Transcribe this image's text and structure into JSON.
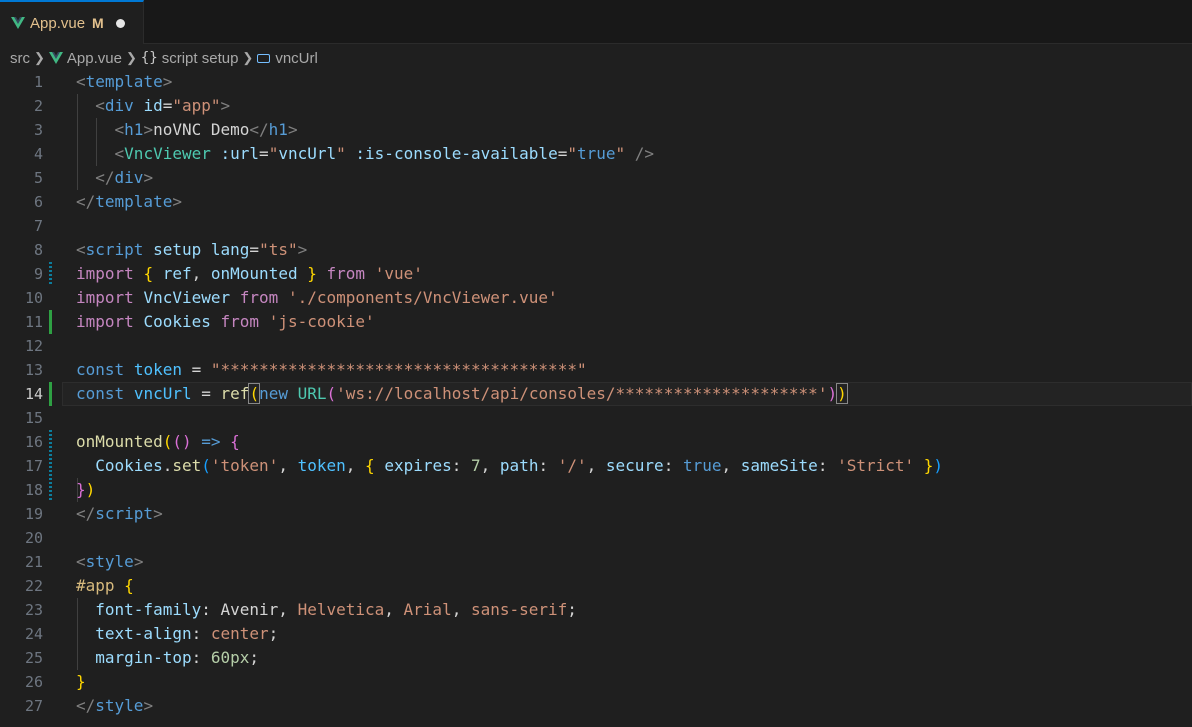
{
  "tab": {
    "filename": "App.vue",
    "status": "M"
  },
  "breadcrumb": {
    "folder": "src",
    "file": "App.vue",
    "braces": "{}",
    "section": "script setup",
    "symbol": "vncUrl"
  },
  "editor": {
    "active_line": 14,
    "line_numbers": [
      "1",
      "2",
      "3",
      "4",
      "5",
      "6",
      "7",
      "8",
      "9",
      "10",
      "11",
      "12",
      "13",
      "14",
      "15",
      "16",
      "17",
      "18",
      "19",
      "20",
      "21",
      "22",
      "23",
      "24",
      "25",
      "26",
      "27"
    ],
    "lines": [
      [
        [
          "<",
          "c-punc"
        ],
        [
          "template",
          "c-tag"
        ],
        [
          ">",
          "c-punc"
        ]
      ],
      [
        [
          "  ",
          "c-text"
        ],
        [
          "<",
          "c-punc"
        ],
        [
          "div",
          "c-tag"
        ],
        [
          " ",
          "c-text"
        ],
        [
          "id",
          "c-attr"
        ],
        [
          "=",
          "c-text"
        ],
        [
          "\"app\"",
          "c-str"
        ],
        [
          ">",
          "c-punc"
        ]
      ],
      [
        [
          "    ",
          "c-text"
        ],
        [
          "<",
          "c-punc"
        ],
        [
          "h1",
          "c-tag"
        ],
        [
          ">",
          "c-punc"
        ],
        [
          "noVNC Demo",
          "c-text"
        ],
        [
          "</",
          "c-punc"
        ],
        [
          "h1",
          "c-tag"
        ],
        [
          ">",
          "c-punc"
        ]
      ],
      [
        [
          "    ",
          "c-text"
        ],
        [
          "<",
          "c-punc"
        ],
        [
          "VncViewer",
          "c-comp"
        ],
        [
          " ",
          "c-text"
        ],
        [
          ":url",
          "c-attr"
        ],
        [
          "=",
          "c-text"
        ],
        [
          "\"",
          "c-str"
        ],
        [
          "vncUrl",
          "c-var"
        ],
        [
          "\"",
          "c-str"
        ],
        [
          " ",
          "c-text"
        ],
        [
          ":is-console-available",
          "c-attr"
        ],
        [
          "=",
          "c-text"
        ],
        [
          "\"",
          "c-str"
        ],
        [
          "true",
          "c-storage"
        ],
        [
          "\"",
          "c-str"
        ],
        [
          " ",
          "c-text"
        ],
        [
          "/>",
          "c-punc"
        ]
      ],
      [
        [
          "  ",
          "c-text"
        ],
        [
          "</",
          "c-punc"
        ],
        [
          "div",
          "c-tag"
        ],
        [
          ">",
          "c-punc"
        ]
      ],
      [
        [
          "</",
          "c-punc"
        ],
        [
          "template",
          "c-tag"
        ],
        [
          ">",
          "c-punc"
        ]
      ],
      [],
      [
        [
          "<",
          "c-punc"
        ],
        [
          "script",
          "c-tag"
        ],
        [
          " ",
          "c-text"
        ],
        [
          "setup",
          "c-attr"
        ],
        [
          " ",
          "c-text"
        ],
        [
          "lang",
          "c-attr"
        ],
        [
          "=",
          "c-text"
        ],
        [
          "\"ts\"",
          "c-str"
        ],
        [
          ">",
          "c-punc"
        ]
      ],
      [
        [
          "import",
          "c-kw"
        ],
        [
          " ",
          "c-text"
        ],
        [
          "{",
          "c-br1"
        ],
        [
          " ",
          "c-text"
        ],
        [
          "ref",
          "c-var"
        ],
        [
          ", ",
          "c-text"
        ],
        [
          "onMounted",
          "c-var"
        ],
        [
          " ",
          "c-text"
        ],
        [
          "}",
          "c-br1"
        ],
        [
          " ",
          "c-text"
        ],
        [
          "from",
          "c-kw"
        ],
        [
          " ",
          "c-text"
        ],
        [
          "'vue'",
          "c-str"
        ]
      ],
      [
        [
          "import",
          "c-kw"
        ],
        [
          " ",
          "c-text"
        ],
        [
          "VncViewer",
          "c-var"
        ],
        [
          " ",
          "c-text"
        ],
        [
          "from",
          "c-kw"
        ],
        [
          " ",
          "c-text"
        ],
        [
          "'./components/VncViewer.vue'",
          "c-str"
        ]
      ],
      [
        [
          "import",
          "c-kw"
        ],
        [
          " ",
          "c-text"
        ],
        [
          "Cookies",
          "c-var"
        ],
        [
          " ",
          "c-text"
        ],
        [
          "from",
          "c-kw"
        ],
        [
          " ",
          "c-text"
        ],
        [
          "'js-cookie'",
          "c-str"
        ]
      ],
      [],
      [
        [
          "const",
          "c-storage"
        ],
        [
          " ",
          "c-text"
        ],
        [
          "token",
          "c-const"
        ],
        [
          " ",
          "c-text"
        ],
        [
          "=",
          "c-op"
        ],
        [
          " ",
          "c-text"
        ],
        [
          "\"*************************************\"",
          "c-str"
        ]
      ],
      [
        [
          "const",
          "c-storage"
        ],
        [
          " ",
          "c-text"
        ],
        [
          "vncUrl",
          "c-const"
        ],
        [
          " ",
          "c-text"
        ],
        [
          "=",
          "c-op"
        ],
        [
          " ",
          "c-text"
        ],
        [
          "ref",
          "c-fn"
        ],
        [
          "(",
          "c-br1"
        ],
        [
          "new",
          "c-storage"
        ],
        [
          " ",
          "c-text"
        ],
        [
          "URL",
          "c-class"
        ],
        [
          "(",
          "c-br2"
        ],
        [
          "'ws://localhost/api/consoles/*********************'",
          "c-str"
        ],
        [
          ")",
          "c-br2"
        ],
        [
          ")",
          "c-br1"
        ]
      ],
      [],
      [
        [
          "onMounted",
          "c-fn"
        ],
        [
          "(",
          "c-br1"
        ],
        [
          "(",
          "c-br2"
        ],
        [
          ")",
          "c-br2"
        ],
        [
          " ",
          "c-text"
        ],
        [
          "=>",
          "c-storage"
        ],
        [
          " ",
          "c-text"
        ],
        [
          "{",
          "c-br2"
        ]
      ],
      [
        [
          "  ",
          "c-text"
        ],
        [
          "Cookies",
          "c-var"
        ],
        [
          ".",
          "c-text"
        ],
        [
          "set",
          "c-fn"
        ],
        [
          "(",
          "c-br3"
        ],
        [
          "'token'",
          "c-str"
        ],
        [
          ", ",
          "c-text"
        ],
        [
          "token",
          "c-const"
        ],
        [
          ", ",
          "c-text"
        ],
        [
          "{",
          "c-br1"
        ],
        [
          " ",
          "c-text"
        ],
        [
          "expires",
          "c-prop"
        ],
        [
          ": ",
          "c-text"
        ],
        [
          "7",
          "c-num"
        ],
        [
          ", ",
          "c-text"
        ],
        [
          "path",
          "c-prop"
        ],
        [
          ": ",
          "c-text"
        ],
        [
          "'/'",
          "c-str"
        ],
        [
          ", ",
          "c-text"
        ],
        [
          "secure",
          "c-prop"
        ],
        [
          ": ",
          "c-text"
        ],
        [
          "true",
          "c-storage"
        ],
        [
          ", ",
          "c-text"
        ],
        [
          "sameSite",
          "c-prop"
        ],
        [
          ": ",
          "c-text"
        ],
        [
          "'Strict'",
          "c-str"
        ],
        [
          " ",
          "c-text"
        ],
        [
          "}",
          "c-br1"
        ],
        [
          ")",
          "c-br3"
        ]
      ],
      [
        [
          "}",
          "c-br2"
        ],
        [
          ")",
          "c-br1"
        ]
      ],
      [
        [
          "</",
          "c-punc"
        ],
        [
          "script",
          "c-tag"
        ],
        [
          ">",
          "c-punc"
        ]
      ],
      [],
      [
        [
          "<",
          "c-punc"
        ],
        [
          "style",
          "c-tag"
        ],
        [
          ">",
          "c-punc"
        ]
      ],
      [
        [
          "#app",
          "c-sel"
        ],
        [
          " ",
          "c-text"
        ],
        [
          "{",
          "c-br1"
        ]
      ],
      [
        [
          "  ",
          "c-text"
        ],
        [
          "font-family",
          "c-prop"
        ],
        [
          ": ",
          "c-text"
        ],
        [
          "Avenir",
          "c-text"
        ],
        [
          ", ",
          "c-text"
        ],
        [
          "Helvetica",
          "c-str"
        ],
        [
          ", ",
          "c-text"
        ],
        [
          "Arial",
          "c-str"
        ],
        [
          ", ",
          "c-text"
        ],
        [
          "sans-serif",
          "c-str"
        ],
        [
          ";",
          "c-text"
        ]
      ],
      [
        [
          "  ",
          "c-text"
        ],
        [
          "text-align",
          "c-prop"
        ],
        [
          ": ",
          "c-text"
        ],
        [
          "center",
          "c-str"
        ],
        [
          ";",
          "c-text"
        ]
      ],
      [
        [
          "  ",
          "c-text"
        ],
        [
          "margin-top",
          "c-prop"
        ],
        [
          ": ",
          "c-text"
        ],
        [
          "60px",
          "c-num"
        ],
        [
          ";",
          "c-text"
        ]
      ],
      [
        [
          "}",
          "c-br1"
        ]
      ],
      [
        [
          "</",
          "c-punc"
        ],
        [
          "style",
          "c-tag"
        ],
        [
          ">",
          "c-punc"
        ]
      ]
    ]
  },
  "colors": {
    "background": "#1f1f1f",
    "modified": "#e2c08d",
    "gutter_added": "#2ea043",
    "gutter_modified": "#0c7d9d",
    "vue_green": "#41b883"
  }
}
